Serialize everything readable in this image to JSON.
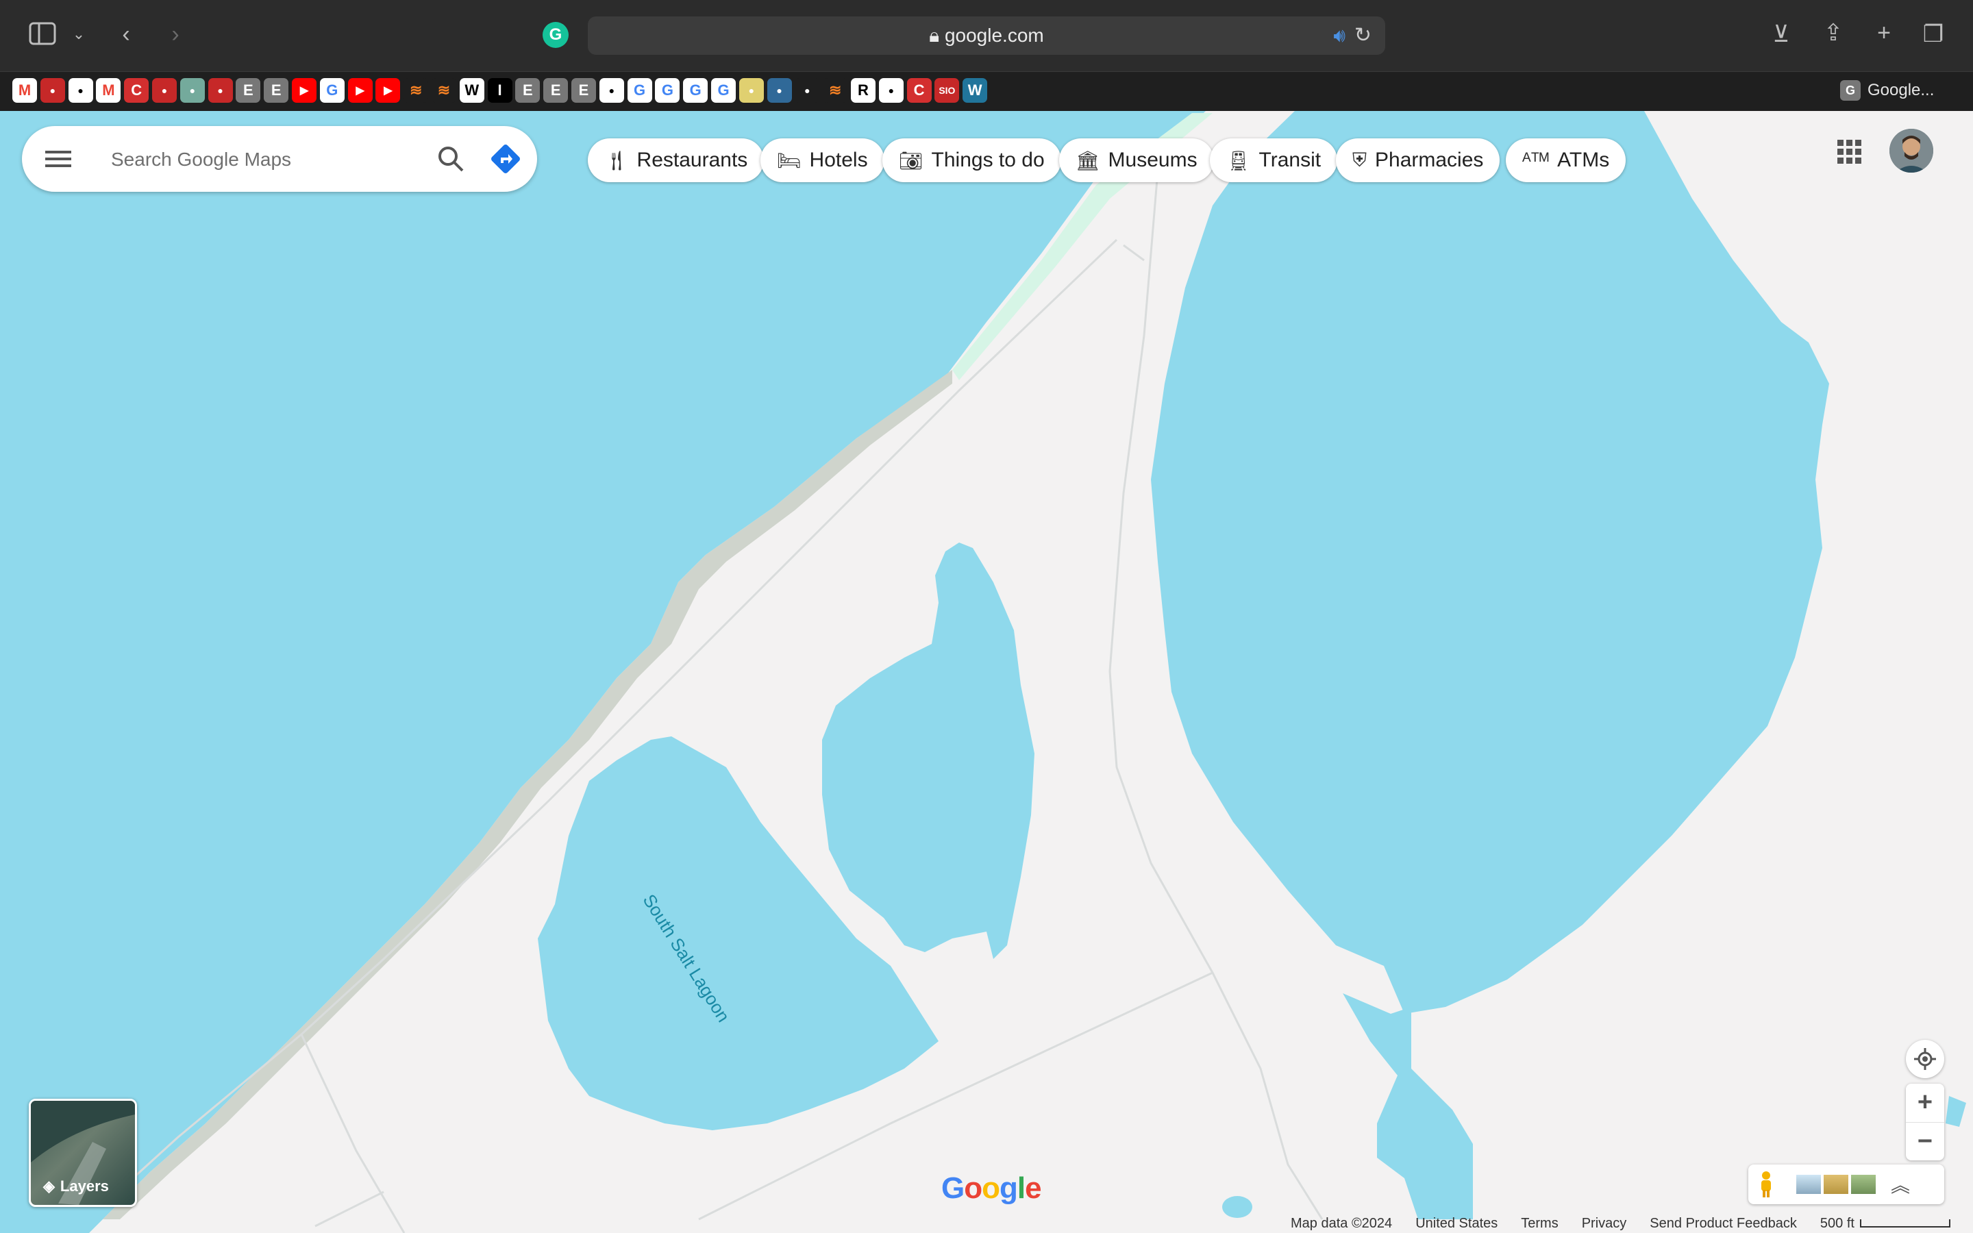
{
  "browser": {
    "url": "google.com",
    "last_tab_label": "Google...",
    "bookmarks": [
      "gmail-icon",
      "bookmark-icon",
      "video-icon",
      "gmail-icon",
      "c-icon",
      "bookmark-icon",
      "openai-icon",
      "bookmark-icon",
      "e-icon",
      "e-icon",
      "youtube-icon",
      "google-icon",
      "youtube-icon",
      "youtube-icon",
      "stackoverflow-icon",
      "stackoverflow-icon",
      "wikipedia-icon",
      "i-icon",
      "e-icon",
      "e-icon",
      "e-icon",
      "diamond-icon",
      "google-icon",
      "google-icon",
      "google-icon",
      "google-icon",
      "circle-icon",
      "python-icon",
      "github-icon",
      "stackoverflow-icon",
      "r-icon",
      "chart-icon",
      "c-icon",
      "sio-icon",
      "wordpress-icon"
    ],
    "bookmark_text": [
      "",
      "",
      "",
      "",
      "C",
      "",
      "",
      "",
      "E",
      "E",
      "",
      "G",
      "",
      "",
      "",
      "",
      "W",
      "I",
      "E",
      "E",
      "E",
      "",
      "G",
      "G",
      "G",
      "G",
      "",
      "",
      "",
      "",
      "R",
      "",
      "C",
      "SIO",
      "W"
    ]
  },
  "search": {
    "placeholder": "Search Google Maps"
  },
  "chips": [
    {
      "label": "Restaurants",
      "icon": "fork-knife-icon"
    },
    {
      "label": "Hotels",
      "icon": "bed-icon"
    },
    {
      "label": "Things to do",
      "icon": "camera-icon"
    },
    {
      "label": "Museums",
      "icon": "museum-icon"
    },
    {
      "label": "Transit",
      "icon": "train-icon"
    },
    {
      "label": "Pharmacies",
      "icon": "pharmacy-icon"
    },
    {
      "label": "ATMs",
      "icon": "atm-icon"
    }
  ],
  "map": {
    "lagoon_label": "South Salt Lagoon",
    "layers_label": "Layers",
    "water_color": "#8fd9ec",
    "land_color": "#f3f2f2"
  },
  "footer": {
    "map_data": "Map data ©2024",
    "country": "United States",
    "terms": "Terms",
    "privacy": "Privacy",
    "feedback": "Send Product Feedback",
    "scale": "500 ft"
  },
  "logo": "Google"
}
